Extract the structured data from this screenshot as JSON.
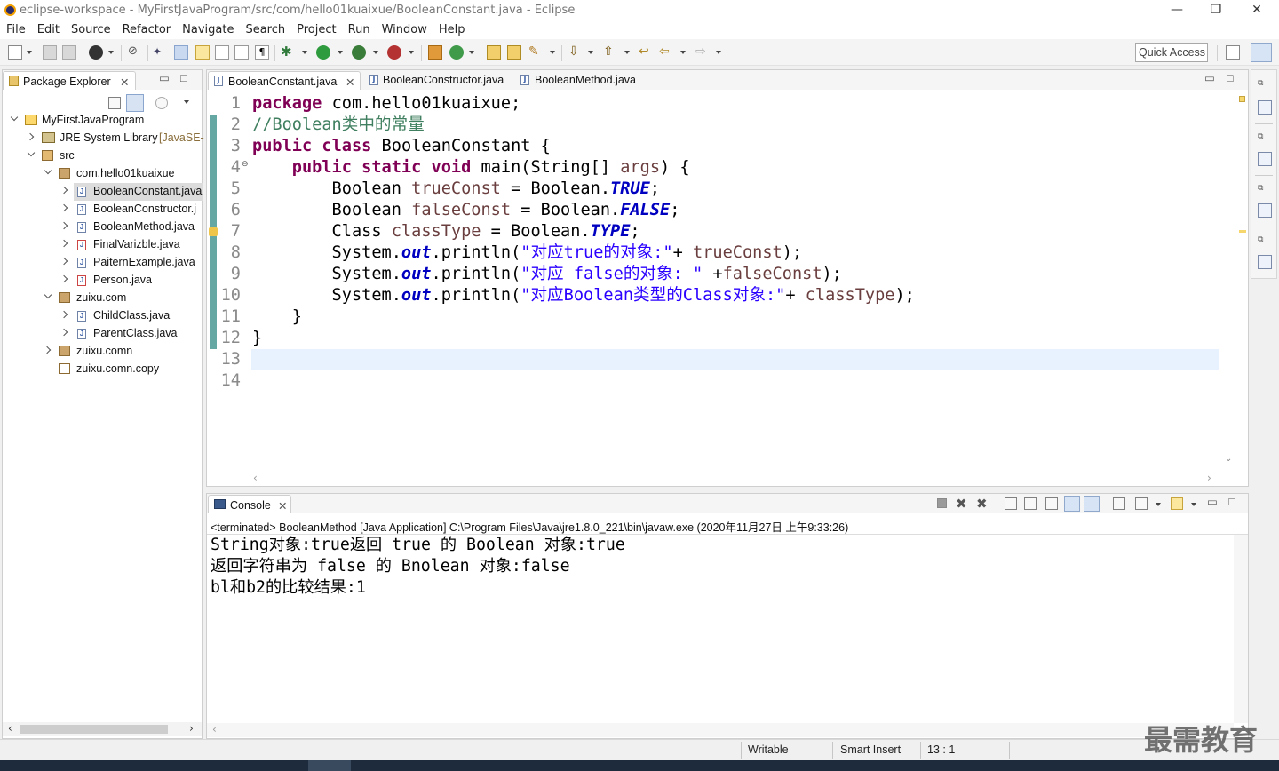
{
  "window": {
    "title": "eclipse-workspace - MyFirstJavaProgram/src/com/hello01kuaixue/BooleanConstant.java - Eclipse",
    "minimize": "—",
    "restore": "❐",
    "close": "✕"
  },
  "menu": [
    "File",
    "Edit",
    "Source",
    "Refactor",
    "Navigate",
    "Search",
    "Project",
    "Run",
    "Window",
    "Help"
  ],
  "toolbar": {
    "quick_access": "Quick Access"
  },
  "package_explorer": {
    "title": "Package Explorer",
    "items": [
      {
        "label": "MyFirstJavaProgram",
        "suffix": "",
        "icon": "project-icon"
      },
      {
        "label": "JRE System Library",
        "suffix": "[JavaSE-",
        "icon": "library-icon"
      },
      {
        "label": "src",
        "suffix": "",
        "icon": "source-folder-icon"
      },
      {
        "label": "com.hello01kuaixue",
        "suffix": "",
        "icon": "package-icon"
      },
      {
        "label": "BooleanConstant.java",
        "suffix": "",
        "icon": "java-file-icon"
      },
      {
        "label": "BooleanConstructor.j",
        "suffix": "",
        "icon": "java-file-icon"
      },
      {
        "label": "BooleanMethod.java",
        "suffix": "",
        "icon": "java-file-icon"
      },
      {
        "label": "FinalVarizble.java",
        "suffix": "",
        "icon": "java-file-error-icon"
      },
      {
        "label": "PaiternExample.java",
        "suffix": "",
        "icon": "java-file-icon"
      },
      {
        "label": "Person.java",
        "suffix": "",
        "icon": "java-file-error-icon"
      },
      {
        "label": "zuixu.com",
        "suffix": "",
        "icon": "package-icon"
      },
      {
        "label": "ChildClass.java",
        "suffix": "",
        "icon": "java-file-icon"
      },
      {
        "label": "ParentClass.java",
        "suffix": "",
        "icon": "java-file-icon"
      },
      {
        "label": "zuixu.comn",
        "suffix": "",
        "icon": "package-icon"
      },
      {
        "label": "zuixu.comn.copy",
        "suffix": "",
        "icon": "empty-package-icon"
      }
    ]
  },
  "editor": {
    "tabs": [
      {
        "label": "BooleanConstant.java",
        "active": true
      },
      {
        "label": "BooleanConstructor.java",
        "active": false
      },
      {
        "label": "BooleanMethod.java",
        "active": false
      }
    ],
    "line_numbers": [
      "1",
      "2",
      "3",
      "4",
      "5",
      "6",
      "7",
      "8",
      "9",
      "10",
      "11",
      "12",
      "13",
      "14"
    ],
    "code": {
      "l1_kw": "package",
      "l1_rest": " com.hello01kuaixue;",
      "l2": "//Boolean类中的常量",
      "l3_kw1": "public",
      "l3_sp1": " ",
      "l3_kw2": "class",
      "l3_rest": " BooleanConstant {",
      "l4_indent": "    ",
      "l4_kw1": "public",
      "l4_kw2": "static",
      "l4_kw3": "void",
      "l4_rest1": " main(String[] ",
      "l4_var": "args",
      "l4_rest2": ") {",
      "l5_a": "        Boolean ",
      "l5_var": "trueConst",
      "l5_b": " = Boolean.",
      "l5_f": "TRUE",
      "l5_c": ";",
      "l6_a": "        Boolean ",
      "l6_var": "falseConst",
      "l6_b": " = Boolean.",
      "l6_f": "FALSE",
      "l6_c": ";",
      "l7_a": "        Class ",
      "l7_var": "classType",
      "l7_b": " = Boolean.",
      "l7_f": "TYPE",
      "l7_c": ";",
      "l8_a": "        System.",
      "l8_f": "out",
      "l8_b": ".println(",
      "l8_s": "\"对应true的对象:\"",
      "l8_c": "+ ",
      "l8_var": "trueConst",
      "l8_d": ");",
      "l9_a": "        System.",
      "l9_f": "out",
      "l9_b": ".println(",
      "l9_s": "\"对应 false的对象: \"",
      "l9_c": " +",
      "l9_var": "falseConst",
      "l9_d": ");",
      "l10_a": "        System.",
      "l10_f": "out",
      "l10_b": ".println(",
      "l10_s": "\"对应Boolean类型的Class对象:\"",
      "l10_c": "+ ",
      "l10_var": "classType",
      "l10_d": ");",
      "l11": "    }",
      "l12": "}"
    }
  },
  "console": {
    "title": "Console",
    "header": "<terminated> BooleanMethod [Java Application] C:\\Program Files\\Java\\jre1.8.0_221\\bin\\javaw.exe (2020年11月27日 上午9:33:26)",
    "output": [
      "String对象:true返回 true 的 Boolean 对象:true",
      "返回字符串为 false 的 Bnolean 对象:false",
      "bl和b2的比较结果:1"
    ]
  },
  "status_bar": {
    "writable": "Writable",
    "insert_mode": "Smart Insert",
    "position": "13 : 1"
  },
  "watermark": "最需教育"
}
